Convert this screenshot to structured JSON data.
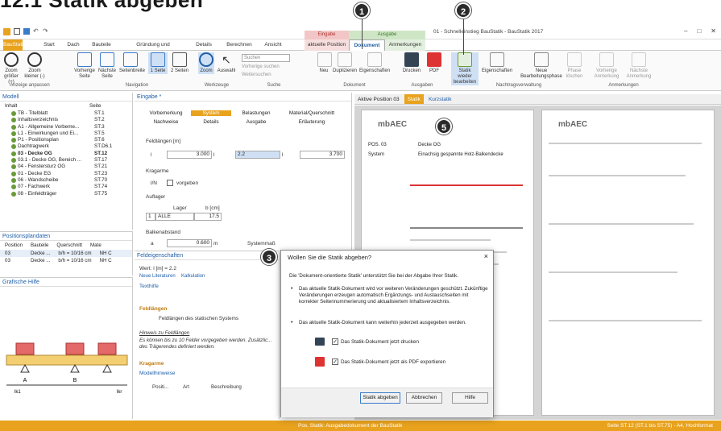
{
  "heading": "12.1 Statik abgeben",
  "markers": [
    "1",
    "2",
    "3",
    "5"
  ],
  "window": {
    "title": "01 - Schnelleinstieg BauStatik - BauStatik 2017",
    "controls": [
      "–",
      "□",
      "✕"
    ]
  },
  "ribbon_tabs": [
    {
      "label": "BauStatik",
      "active": true
    },
    {
      "label": "Start"
    },
    {
      "label": "Dach"
    },
    {
      "label": "Bauteile"
    },
    {
      "label": "Gründung und Grundbau"
    },
    {
      "label": "Details"
    },
    {
      "label": "Berechnen"
    },
    {
      "label": "Ansicht"
    },
    {
      "label": "aktuelle Position"
    },
    {
      "label": "Dokument",
      "active_context": true
    },
    {
      "label": "Anmerkungen"
    }
  ],
  "context_groups": {
    "eingabe": "Eingabe",
    "ausgabe": "Ausgabe"
  },
  "ribbon": {
    "buttons": [
      {
        "name": "zoom-groesser",
        "label": "Zoom größer (+)"
      },
      {
        "name": "zoom-kleiner",
        "label": "Zoom kleiner (-)"
      },
      {
        "name": "vorherige-seite",
        "label": "Vorherige Seite"
      },
      {
        "name": "naechste-seite",
        "label": "Nächste Seite"
      },
      {
        "name": "seitenbreite",
        "label": "Seitenbreite"
      },
      {
        "name": "eine-seite",
        "label": "1 Seite"
      },
      {
        "name": "zwei-seiten",
        "label": "2 Seiten"
      },
      {
        "name": "zoom",
        "label": "Zoom"
      },
      {
        "name": "auswahl",
        "label": "Auswahl"
      },
      {
        "name": "neu",
        "label": "Neu"
      },
      {
        "name": "duplizieren",
        "label": "Duplizieren"
      },
      {
        "name": "eigenschaften",
        "label": "Eigenschaften"
      },
      {
        "name": "drucken",
        "label": "Drucken"
      },
      {
        "name": "pdf",
        "label": "PDF"
      },
      {
        "name": "statik-wieder-bearbeiten",
        "label": "Statik wieder bearbeiten"
      },
      {
        "name": "eigenschaften-2",
        "label": "Eigenschaften"
      },
      {
        "name": "neue-bearbeitungsphase",
        "label": "Neue Bearbeitungsphase"
      },
      {
        "name": "phase-loeschen",
        "label": "Phase löschen"
      },
      {
        "name": "vorherige-anmerkung",
        "label": "Vorherige Anmerkung"
      },
      {
        "name": "naechste-anmerkung",
        "label": "Nächste Anmerkung"
      }
    ],
    "search_placeholder": "Suchen",
    "search_prev": "Vorherige suchen",
    "search_next": "Weitersuchen",
    "groups": [
      "Anzeige anpassen",
      "Navigation",
      "Werkzeuge",
      "Suche",
      "Dokument",
      "Ausgaben",
      "Nachtragsverwaltung",
      "Anmerkungen"
    ]
  },
  "model_panel": {
    "title": "Modell",
    "col_inhalt": "Inhalt",
    "col_seite": "Seite",
    "rows": [
      {
        "n": "TB - Titelblatt",
        "s": "ST.1"
      },
      {
        "n": "Inhaltsverzeichnis",
        "s": "ST.2"
      },
      {
        "n": "A1 - Allgemeine Vorbeme...",
        "s": "ST.3"
      },
      {
        "n": "L1 - Einwirkungen und Ei...",
        "s": "ST.5"
      },
      {
        "n": "P1 - Positionsplan",
        "s": "ST.6"
      },
      {
        "n": "Dachtragwerk",
        "s": "ST.D6.1"
      },
      {
        "n": "03 - Decke OG",
        "s": "ST.12",
        "bold": true
      },
      {
        "n": "03.1 - Decke OG, Bereich ...",
        "s": "ST.17"
      },
      {
        "n": "04 - Fenstersturz OG",
        "s": "ST.21"
      },
      {
        "n": "01 - Decke EG",
        "s": "ST.23"
      },
      {
        "n": "06 - Wandscheibe",
        "s": "ST.70"
      },
      {
        "n": "07 - Fachwerk",
        "s": "ST.74"
      },
      {
        "n": "08 - Einfeldträger",
        "s": "ST.75"
      }
    ]
  },
  "positionsplan_panel": {
    "title": "Positionsplandaten",
    "cols": [
      "Position",
      "Bauteile",
      "Querschnitt",
      "Mate"
    ],
    "rows": [
      [
        "03",
        "Decke ...",
        "b/h = 10/16 cm",
        "NH C"
      ],
      [
        "03",
        "Decke ...",
        "b/h = 10/16 cm",
        "NH C"
      ]
    ]
  },
  "grafik_panel": {
    "title": "Grafische Hilfe",
    "labels": [
      "A",
      "B",
      "lk1",
      "lkr"
    ]
  },
  "eingabe_panel": {
    "title": "Eingabe *",
    "tabs_row1": [
      "Vorbemerkung",
      "System",
      "Belastungen",
      "Material/Querschnitt"
    ],
    "tabs_row2": [
      "Nachweise",
      "Details",
      "Ausgabe",
      "Erläuterung"
    ],
    "feldlaengen": "Feldlängen [m]",
    "l1": "l",
    "l1_val": "3.000",
    "l2": "l",
    "l2_val": "2.2",
    "l3": "l",
    "l3_val": "3.700",
    "kragarme": "Kragarme",
    "krag_label": "l/N",
    "vorgeben": "vorgeben",
    "auflager": "Auflager",
    "lager_head": "Lager",
    "b_head": "b [cm]",
    "lager_row": [
      "1",
      "ALLE",
      "17.5"
    ],
    "balkenabstand": "Balkenabstand",
    "a_label": "a",
    "a_val": "0.600",
    "a_unit": "m",
    "systemmass": "Systemmaß"
  },
  "feld_panel": {
    "title": "Feldeigenschaften",
    "wert": "Wert: l [m] = 2.2",
    "links": [
      "Neue Literaturen",
      "Kalkulation"
    ],
    "texthilfe": "Texthilfe",
    "fl_head": "Feldlängen",
    "fl_text": "Feldlängen des statischen Systems",
    "hinweis_title": "Hinweis zu Feldlängen",
    "hinweis_text": "Es können bis zu 10 Felder vorgegeben werden. Zusätzlic... des Trägerendes definiert werden.",
    "kragarme": "Kragarme",
    "modellhinweise": "Modellhinweise",
    "mh_cols": [
      "Positi...",
      "Art",
      "Beschreibung"
    ]
  },
  "doc_tabs": [
    {
      "label": "Aktive Position 03"
    },
    {
      "label": "Statik",
      "active": true
    },
    {
      "label": "Kurzstatik"
    }
  ],
  "dialog": {
    "title": "Wollen Sie die Statik abgeben?",
    "intro": "Die 'Dokument-orientierte Statik' unterstützt Sie bei der Abgabe Ihrer Statik.",
    "bullet1": "Das aktuelle Statik-Dokument wird vor weiteren Veränderungen geschützt. Zukünftige Veränderungen erzeugen automatisch Ergänzungs- und Austauschseiten mit korrekter Seitennummerierung und aktualisiertem Inhaltsverzeichnis.",
    "bullet2": "Das aktuelle Statik-Dokument kann weiterhin jederzeit ausgegeben werden.",
    "opt_print": "Das Statik-Dokument jetzt drucken",
    "opt_pdf": "Das Statik-Dokument jetzt als PDF exportieren",
    "btn_ok": "Statik abgeben",
    "btn_cancel": "Abbrechen",
    "btn_help": "Hilfe"
  },
  "doc_page": {
    "logo": "mbAEC",
    "pos": "POS. 03",
    "pos_title": "Decke OG",
    "system": "System",
    "system_text": "Einachsig gespannte Holz-Balkendecke",
    "page2_logo": "mbAEC"
  },
  "status": {
    "center": "Pos. Statik: Ausgabedokument der BauStatik",
    "right": "Seite ST.12 (ST.1 bis ST.75) - A4, Hochformat"
  },
  "colors": {
    "accent": "#e8a21d",
    "ribbon_blue": "#1f5fa8",
    "context_red": "#f2c6c6",
    "context_green": "#cfe6c6"
  }
}
